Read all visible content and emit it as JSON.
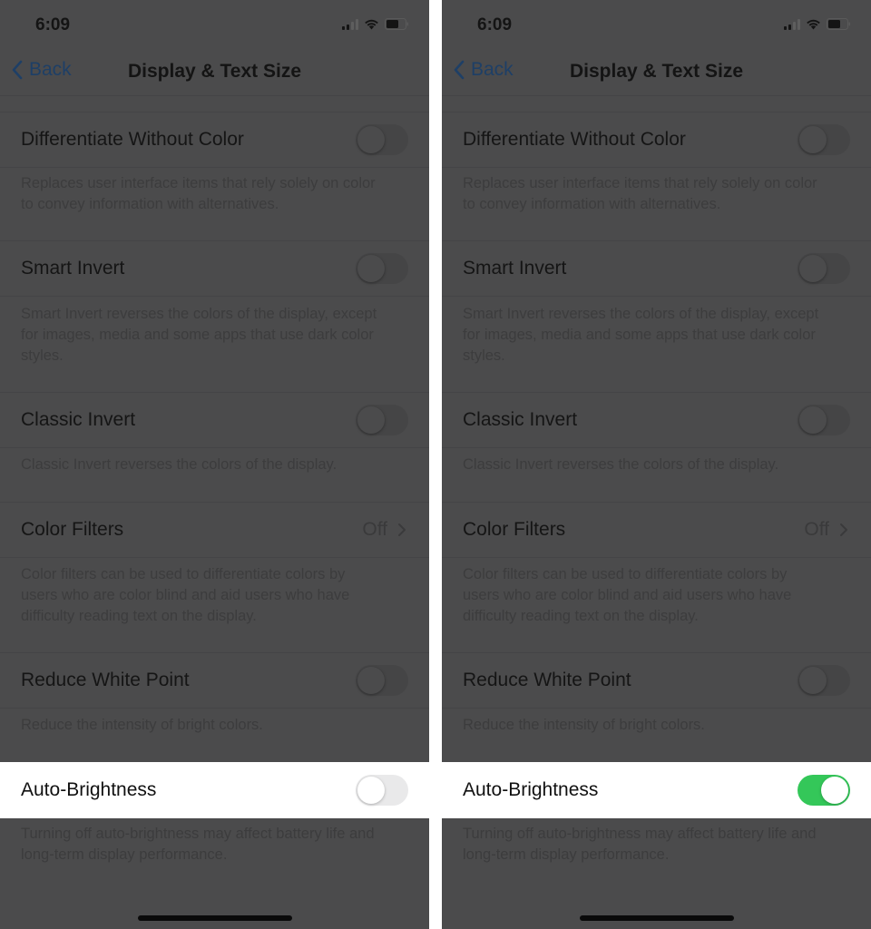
{
  "screens": [
    {
      "status_bar": {
        "time": "6:09",
        "signal": "signal-icon",
        "wifi": "wifi-icon",
        "battery": "battery-icon"
      },
      "nav": {
        "back_label": "Back",
        "title": "Display & Text Size"
      },
      "rows": [
        {
          "label": "Differentiate Without Color",
          "type": "toggle",
          "on": false,
          "footer": [
            "Replaces user interface items that rely solely on color",
            "to convey information with alternatives."
          ]
        },
        {
          "label": "Smart Invert",
          "type": "toggle",
          "on": false,
          "footer": [
            "Smart Invert reverses the colors of the display, except",
            "for images, media and some apps that use dark color",
            "styles."
          ]
        },
        {
          "label": "Classic Invert",
          "type": "toggle",
          "on": false,
          "footer": [
            "Classic Invert reverses the colors of the display."
          ]
        },
        {
          "label": "Color Filters",
          "type": "disclosure",
          "value": "Off",
          "footer": [
            "Color filters can be used to differentiate colors by",
            "users who are color blind and aid users who have",
            "difficulty reading text on the display."
          ]
        },
        {
          "label": "Reduce White Point",
          "type": "toggle",
          "on": false,
          "footer": [
            "Reduce the intensity of bright colors."
          ]
        },
        {
          "label": "Auto-Brightness",
          "type": "toggle",
          "on": false,
          "highlighted": true,
          "footer": [
            "Turning off auto-brightness may affect battery life and",
            "long-term display performance."
          ]
        }
      ]
    },
    {
      "status_bar": {
        "time": "6:09",
        "signal": "signal-icon",
        "wifi": "wifi-icon",
        "battery": "battery-icon"
      },
      "nav": {
        "back_label": "Back",
        "title": "Display & Text Size"
      },
      "rows": [
        {
          "label": "Differentiate Without Color",
          "type": "toggle",
          "on": false,
          "footer": [
            "Replaces user interface items that rely solely on color",
            "to convey information with alternatives."
          ]
        },
        {
          "label": "Smart Invert",
          "type": "toggle",
          "on": false,
          "footer": [
            "Smart Invert reverses the colors of the display, except",
            "for images, media and some apps that use dark color",
            "styles."
          ]
        },
        {
          "label": "Classic Invert",
          "type": "toggle",
          "on": false,
          "footer": [
            "Classic Invert reverses the colors of the display."
          ]
        },
        {
          "label": "Color Filters",
          "type": "disclosure",
          "value": "Off",
          "footer": [
            "Color filters can be used to differentiate colors by",
            "users who are color blind and aid users who have",
            "difficulty reading text on the display."
          ]
        },
        {
          "label": "Reduce White Point",
          "type": "toggle",
          "on": false,
          "footer": [
            "Reduce the intensity of bright colors."
          ]
        },
        {
          "label": "Auto-Brightness",
          "type": "toggle",
          "on": true,
          "highlighted": true,
          "footer": [
            "Turning off auto-brightness may affect battery life and",
            "long-term display performance."
          ]
        }
      ]
    }
  ],
  "colors": {
    "toggle_on": "#34c759",
    "back_link": "#007aff",
    "dim_overlay": "#4b4b4c"
  }
}
